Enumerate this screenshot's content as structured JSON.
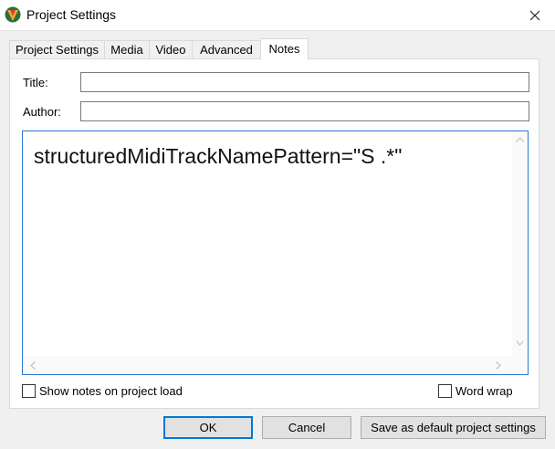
{
  "window": {
    "title": "Project Settings"
  },
  "tabs": [
    {
      "label": "Project Settings"
    },
    {
      "label": "Media"
    },
    {
      "label": "Video"
    },
    {
      "label": "Advanced"
    },
    {
      "label": "Notes",
      "active": true
    }
  ],
  "form": {
    "title_label": "Title:",
    "title_value": "",
    "author_label": "Author:",
    "author_value": "",
    "notes_text": "structuredMidiTrackNamePattern=\"S .*\""
  },
  "options": {
    "show_notes_label": "Show notes on project load",
    "show_notes_checked": false,
    "word_wrap_label": "Word wrap",
    "word_wrap_checked": false
  },
  "buttons": {
    "ok": "OK",
    "cancel": "Cancel",
    "save_default": "Save as default project settings"
  },
  "icons": {
    "app": "reaper-logo-icon",
    "close": "close-icon"
  },
  "colors": {
    "accent": "#0078d7",
    "focus_border": "#2b79d6"
  }
}
